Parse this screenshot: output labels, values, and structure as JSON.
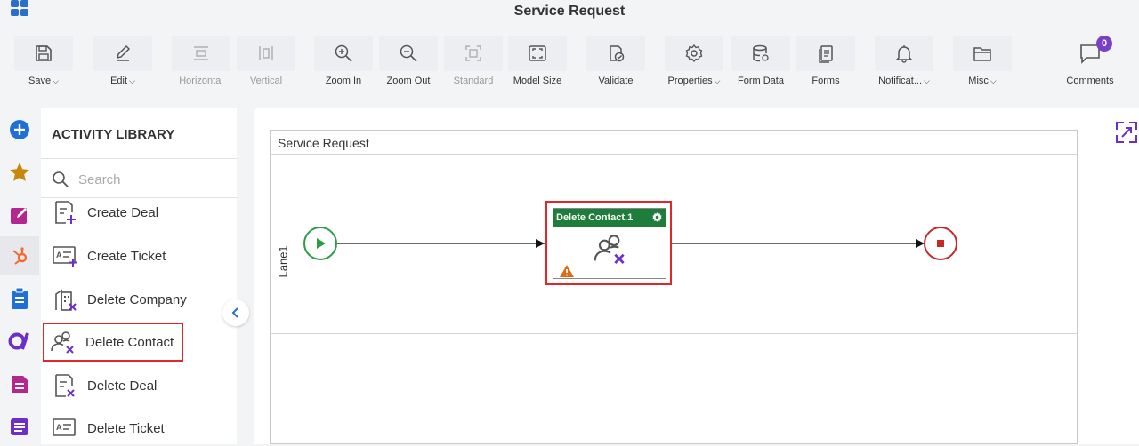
{
  "app": {
    "title": "Service Request"
  },
  "toolbar": {
    "save": "Save",
    "edit": "Edit",
    "horizontal": "Horizontal",
    "vertical": "Vertical",
    "zoom_in": "Zoom In",
    "zoom_out": "Zoom Out",
    "standard": "Standard",
    "model_size": "Model Size",
    "validate": "Validate",
    "properties": "Properties",
    "form_data": "Form Data",
    "forms": "Forms",
    "notifications": "Notificat...",
    "misc": "Misc",
    "comments": "Comments",
    "comments_count": "0"
  },
  "rail": {
    "icons": [
      "add-icon",
      "star-icon",
      "edit-note-icon",
      "hubspot-icon",
      "clipboard-icon",
      "brand-icon",
      "document-icon",
      "list-icon"
    ]
  },
  "library": {
    "title": "ACTIVITY LIBRARY",
    "search_placeholder": "Search",
    "items": [
      {
        "label": "Create Deal",
        "icon": "create-deal-icon"
      },
      {
        "label": "Create Ticket",
        "icon": "create-ticket-icon"
      },
      {
        "label": "Delete Company",
        "icon": "delete-company-icon"
      },
      {
        "label": "Delete Contact",
        "icon": "delete-contact-icon",
        "selected": true
      },
      {
        "label": "Delete Deal",
        "icon": "delete-deal-icon"
      },
      {
        "label": "Delete Ticket",
        "icon": "delete-ticket-icon"
      }
    ]
  },
  "canvas": {
    "pool_title": "Service Request",
    "lane_label": "Lane1",
    "activity_title": "Delete Contact.1"
  },
  "colors": {
    "accent": "#7b3fc4",
    "activity_header": "#1e7d3a",
    "highlight": "#e12727",
    "start": "#2e9b47",
    "end": "#c62828"
  }
}
